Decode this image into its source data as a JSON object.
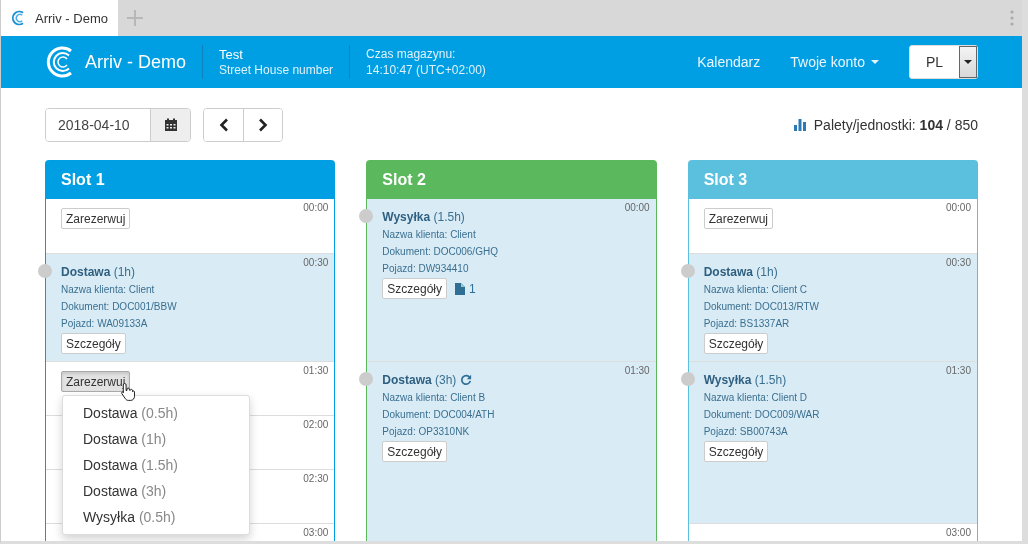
{
  "browser": {
    "tab_title": "Arriv - Demo"
  },
  "header": {
    "brand": "Arriv - Demo",
    "location_name": "Test",
    "location_address": "Street House number",
    "clock_label": "Czas magazynu:",
    "clock_value": "14:10:47 (UTC+02:00)",
    "nav": [
      "Kalendarz",
      "Twoje konto"
    ],
    "language": "PL"
  },
  "toolbar": {
    "date": "2018-04-10",
    "pallets_label": "Palety/jednostki:",
    "pallets_used": "104",
    "pallets_total": "/ 850"
  },
  "slots": [
    {
      "title": "Slot 1",
      "color": "#009fe3",
      "rows": [
        {
          "kind": "free",
          "time": "00:00",
          "button": "Zarezerwuj",
          "pressed": false
        },
        {
          "kind": "booking",
          "time": "00:30",
          "type": "Dostawa",
          "duration": "(1h)",
          "recurring": false,
          "client": "Nazwa klienta: Client",
          "document": "Dokument: DOC001/BBW",
          "vehicle": "Pojazd: WA09133A",
          "details": "Szczegóły"
        },
        {
          "kind": "free",
          "time": "01:30",
          "button": "Zarezerwuj",
          "pressed": true,
          "menu": [
            {
              "type": "Dostawa",
              "duration": "(0.5h)"
            },
            {
              "type": "Dostawa",
              "duration": "(1h)"
            },
            {
              "type": "Dostawa",
              "duration": "(1.5h)"
            },
            {
              "type": "Dostawa",
              "duration": "(3h)"
            },
            {
              "type": "Wysyłka",
              "duration": "(0.5h)"
            }
          ]
        },
        {
          "kind": "free",
          "time": "02:00"
        },
        {
          "kind": "free",
          "time": "02:30"
        },
        {
          "kind": "free",
          "time": "03:00"
        }
      ]
    },
    {
      "title": "Slot 2",
      "color": "#5cb85c",
      "rows": [
        {
          "kind": "booking",
          "time": "00:00",
          "type": "Wysyłka",
          "duration": "(1.5h)",
          "recurring": false,
          "client": "Nazwa klienta: Client",
          "document": "Dokument: DOC006/GHQ",
          "vehicle": "Pojazd: DW934410",
          "details": "Szczegóły",
          "attachments": "1"
        },
        {
          "kind": "booking",
          "time": "01:30",
          "type": "Dostawa",
          "duration": "(3h)",
          "recurring": true,
          "client": "Nazwa klienta: Client B",
          "document": "Dokument: DOC004/ATH",
          "vehicle": "Pojazd: OP3310NK",
          "details": "Szczegóły"
        }
      ]
    },
    {
      "title": "Slot 3",
      "color": "#5bc0de",
      "rows": [
        {
          "kind": "free",
          "time": "00:00",
          "button": "Zarezerwuj",
          "pressed": false
        },
        {
          "kind": "booking",
          "time": "00:30",
          "type": "Dostawa",
          "duration": "(1h)",
          "recurring": false,
          "client": "Nazwa klienta: Client C",
          "document": "Dokument: DOC013/RTW",
          "vehicle": "Pojazd: BS1337AR",
          "details": "Szczegóły"
        },
        {
          "kind": "booking",
          "time": "01:30",
          "type": "Wysyłka",
          "duration": "(1.5h)",
          "recurring": false,
          "client": "Nazwa klienta: Client D",
          "document": "Dokument: DOC009/WAR",
          "vehicle": "Pojazd: SB00743A",
          "details": "Szczegóły"
        },
        {
          "kind": "free",
          "time": "03:00"
        }
      ]
    }
  ]
}
